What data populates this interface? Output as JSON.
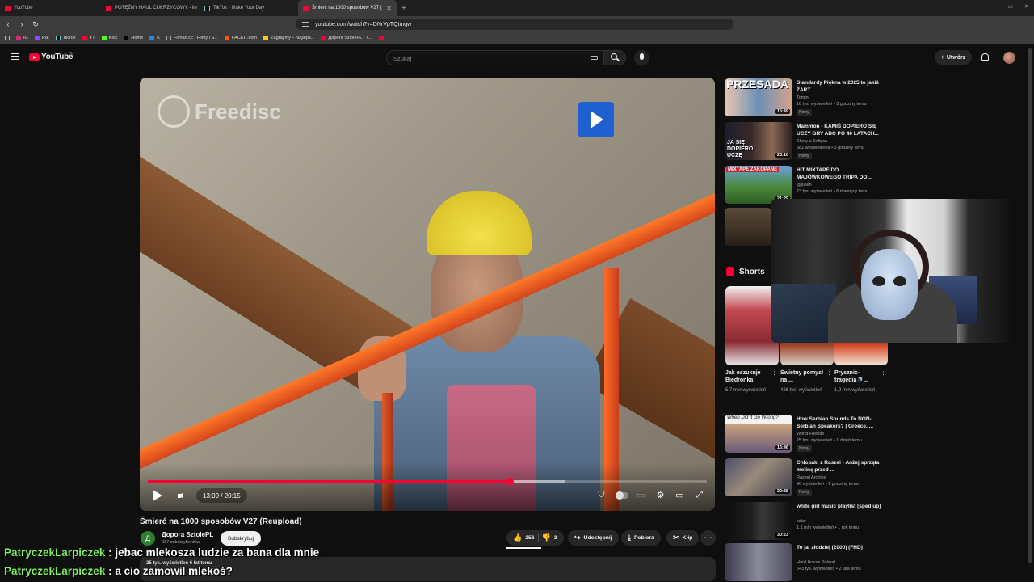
{
  "browser": {
    "tabs": [
      {
        "label": "YouTube",
        "active": false
      },
      {
        "label": "POTĘŻNY HAUL CUKRZYCOWY - ile",
        "active": false
      },
      {
        "label": "TikTok - Make Your Day",
        "active": false
      },
      {
        "label": "Śmierć na 1000 sposobów V27 (",
        "active": true
      }
    ],
    "new_tab": "+",
    "window_controls": [
      "–",
      "▭",
      "✕"
    ],
    "url": "youtube.com/watch?v=DNrVpTQtmqw",
    "bookmarks": [
      "IG",
      "Rat",
      "TikTok",
      "YT",
      "Kick",
      "Home",
      "K",
      "Filman.cc - Filmy i S...",
      "FACEIT.com",
      "Zagraj.my – Najleps...",
      "Дорога SzlolePL - Y..."
    ]
  },
  "header": {
    "logo": "YouTube",
    "country": "PL",
    "search_placeholder": "Szukaj",
    "create_label": "Utwórz"
  },
  "player": {
    "watermark": "Freedisc",
    "time": "13:09 / 20:15",
    "progress_fraction": 0.648,
    "buffer_fraction": 0.745
  },
  "video": {
    "title": "Śmierć na 1000 sposobów V27 (Reupload)",
    "channel": "Дорога SztolePL",
    "channel_initial": "Д",
    "subscribers": "237 subskrybentów",
    "subscribe_label": "Subskrybuj",
    "likes": "256",
    "dislikes": "3",
    "share_label": "Udostępnij",
    "download_label": "Pobierz",
    "clip_label": "Klip",
    "description_meta": "25 tys. wyświetleń  6 lat temu"
  },
  "chat": [
    {
      "user": "PatryczekLarpiczek",
      "message": ": jebac mlekosza ludzie za bana dla mnie"
    },
    {
      "user": "PatryczekLarpiczek",
      "message": ": a cio zamowil mlekoś?"
    }
  ],
  "recommendations_top": [
    {
      "title": "Standardy Piękna w 2025 to jakiś ŻART",
      "channel": "Tomini",
      "meta": "16 tys. wyświetleń • 3 godziny temu",
      "badge": "Nowy",
      "duration": "15:49",
      "thumb_text": "PRZESADA"
    },
    {
      "title": "Mammon - KAMIŚ DOPIERO SIĘ UCZY GRY ADC PO 40 LATACH...",
      "channel": "Shoty u Sołtysa",
      "meta": "582 wyświetlenia • 3 godziny temu",
      "badge": "Nowy",
      "duration": "26:10",
      "thumb_text": "JA SIĘ DOPIERO UCZĘ"
    },
    {
      "title": "HIT MIXTAPE DO MAJÓWKOWEGO TRIPA DO ...",
      "channel": "@jusen",
      "meta": "23 tys. wyświetleń • 6 miesięcy temu",
      "badge": "",
      "duration": "21:29",
      "thumb_text": "MIXTAPE ZAKOPANE"
    }
  ],
  "shorts": {
    "heading": "Shorts",
    "items": [
      {
        "title": "Jak oszukuje Biedronka",
        "views": "5,7 mln wyświetleń"
      },
      {
        "title": "Świetny pomysł na ...",
        "views": "426 tys. wyświetleń"
      },
      {
        "title": "Prysznic-tragedia🚿...",
        "views": "1,9 mln wyświetleń"
      }
    ]
  },
  "recommendations_bottom": [
    {
      "title": "How Serbian Sounds To NON-Serbian Speakers? | Greece, ...",
      "channel": "World Friends",
      "meta": "25 tys. wyświetleń • 1 dzień temu",
      "badge": "Nowy",
      "duration": "16:46",
      "thumb_text": "When Did It Go Wrong?"
    },
    {
      "title": "Chłopaki z Raszei - Anżej sprząta melinę przed ...",
      "channel": "Raszei Archive",
      "meta": "96 wyświetleń • 1 godzinę temu",
      "badge": "Nowy",
      "duration": "29:38",
      "thumb_text": ""
    },
    {
      "title": "white girl music playlist [sped up]",
      "channel": "solar",
      "meta": "1,1 mln wyświetleń • 1 rok temu",
      "badge": "",
      "duration": "30:23",
      "thumb_text": ""
    },
    {
      "title": "To ja, złodziej (2000) (FHD)",
      "channel": "Hard House Poland",
      "meta": "643 tys. wyświetleń • 2 lata temu",
      "badge": "",
      "duration": "",
      "thumb_text": ""
    }
  ]
}
